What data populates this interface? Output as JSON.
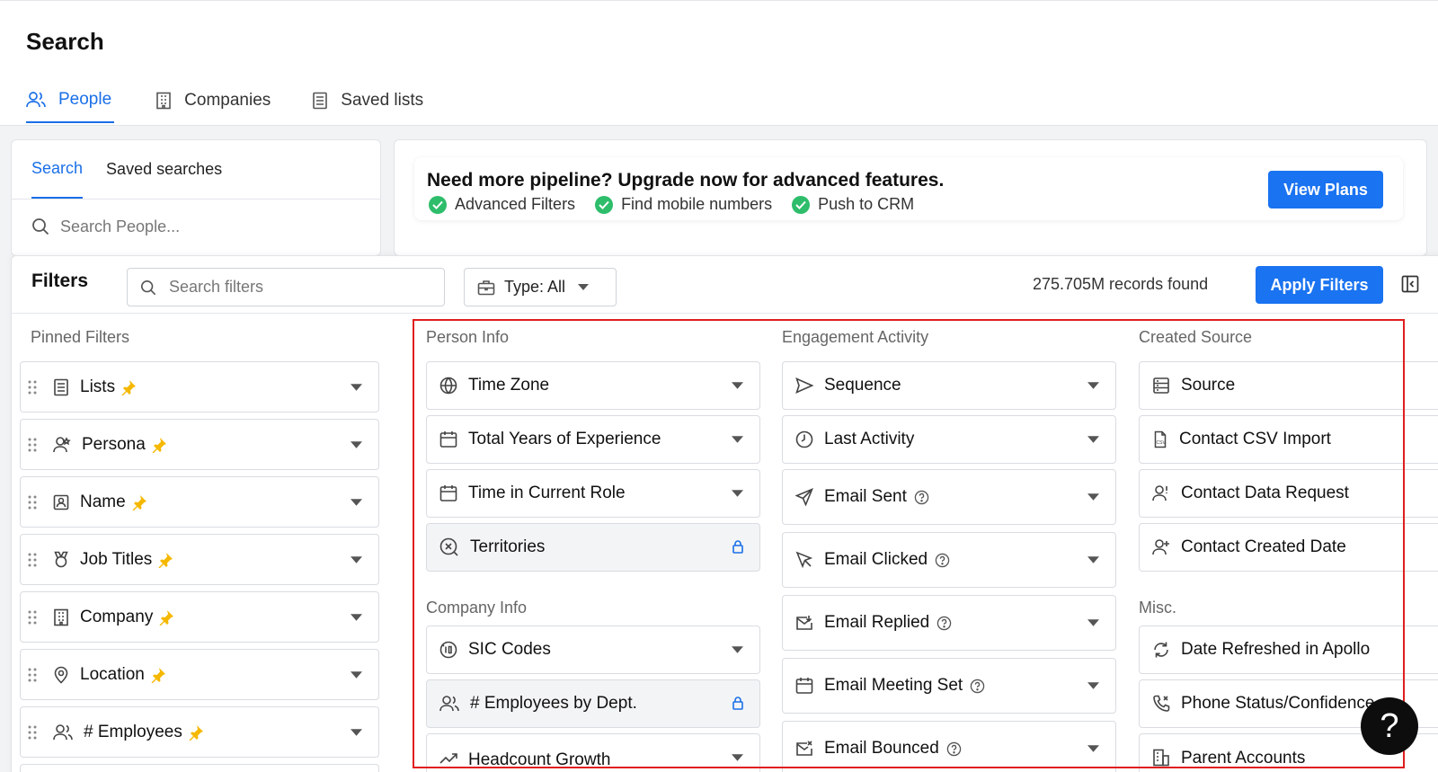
{
  "page": {
    "title": "Search"
  },
  "main_tabs": [
    {
      "label": "People",
      "icon": "users-icon",
      "active": true
    },
    {
      "label": "Companies",
      "icon": "building-icon",
      "active": false
    },
    {
      "label": "Saved lists",
      "icon": "list-icon",
      "active": false
    }
  ],
  "search_panel": {
    "tabs": [
      {
        "label": "Search",
        "active": true
      },
      {
        "label": "Saved searches",
        "active": false
      }
    ],
    "placeholder": "Search People..."
  },
  "banner": {
    "title": "Need more pipeline? Upgrade now for advanced features.",
    "features": [
      "Advanced Filters",
      "Find mobile numbers",
      "Push to CRM"
    ],
    "cta": "View Plans"
  },
  "filters": {
    "title": "Filters",
    "search_placeholder": "Search filters",
    "type_label": "Type: All",
    "records": "275.705M records found",
    "apply": "Apply Filters"
  },
  "pinned": {
    "label": "Pinned Filters",
    "items": [
      {
        "label": "Lists",
        "icon": "list-icon"
      },
      {
        "label": "Persona",
        "icon": "persona-icon"
      },
      {
        "label": "Name",
        "icon": "id-card-icon"
      },
      {
        "label": "Job Titles",
        "icon": "badge-icon"
      },
      {
        "label": "Company",
        "icon": "building-icon"
      },
      {
        "label": "Location",
        "icon": "location-pin-icon"
      },
      {
        "label": "# Employees",
        "icon": "users-icon"
      }
    ]
  },
  "person_info": {
    "label": "Person Info",
    "items": [
      {
        "label": "Time Zone",
        "icon": "globe-icon"
      },
      {
        "label": "Total Years of Experience",
        "icon": "calendar-icon"
      },
      {
        "label": "Time in Current Role",
        "icon": "calendar-icon"
      },
      {
        "label": "Territories",
        "icon": "territory-icon",
        "locked": true
      }
    ]
  },
  "company_info": {
    "label": "Company Info",
    "items": [
      {
        "label": "SIC Codes",
        "icon": "sic-icon"
      },
      {
        "label": "# Employees by Dept.",
        "icon": "users-icon",
        "locked": true
      },
      {
        "label": "Headcount Growth",
        "icon": "trend-icon"
      }
    ]
  },
  "engagement": {
    "label": "Engagement Activity",
    "items": [
      {
        "label": "Sequence",
        "icon": "send-icon"
      },
      {
        "label": "Last Activity",
        "icon": "clock-icon"
      },
      {
        "label": "Email Sent",
        "icon": "paper-plane-icon",
        "help": true
      },
      {
        "label": "Email Clicked",
        "icon": "cursor-icon",
        "help": true
      },
      {
        "label": "Email Replied",
        "icon": "mail-reply-icon",
        "help": true
      },
      {
        "label": "Email Meeting Set",
        "icon": "calendar-icon",
        "help": true
      },
      {
        "label": "Email Bounced",
        "icon": "mail-bounce-icon",
        "help": true
      }
    ]
  },
  "created_source": {
    "label": "Created Source",
    "items": [
      {
        "label": "Source",
        "icon": "database-icon"
      },
      {
        "label": "Contact CSV Import",
        "icon": "csv-file-icon"
      },
      {
        "label": "Contact Data Request",
        "icon": "user-request-icon"
      },
      {
        "label": "Contact Created Date",
        "icon": "user-add-icon"
      }
    ]
  },
  "misc": {
    "label": "Misc.",
    "items": [
      {
        "label": "Date Refreshed in Apollo",
        "icon": "refresh-icon"
      },
      {
        "label": "Phone Status/Confidence",
        "icon": "phone-icon"
      },
      {
        "label": "Parent Accounts",
        "icon": "building-icon"
      }
    ]
  },
  "help_fab": "?",
  "colors": {
    "accent": "#1a73f0",
    "check": "#2ebd6b",
    "highlight": "#e01e1e",
    "pin": "#f5b800"
  }
}
